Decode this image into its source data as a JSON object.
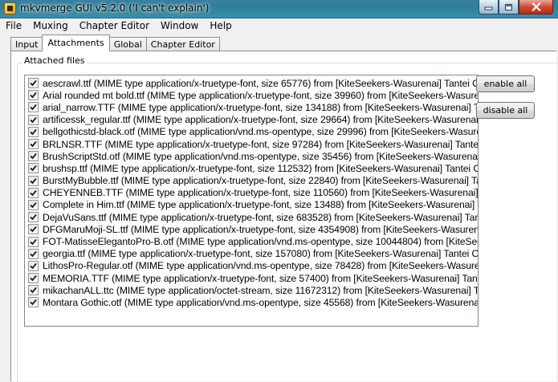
{
  "window": {
    "title": "mkvmerge GUI v5.2.0 ('I can't explain')",
    "controls": [
      "minimize",
      "maximize",
      "close"
    ]
  },
  "menu": [
    "File",
    "Muxing",
    "Chapter Editor",
    "Window",
    "Help"
  ],
  "tabs": [
    {
      "label": "Input",
      "active": false
    },
    {
      "label": "Attachments",
      "active": true
    },
    {
      "label": "Global",
      "active": false
    },
    {
      "label": "Chapter Editor",
      "active": false
    }
  ],
  "attached_files": {
    "label": "Attached files",
    "items": [
      {
        "checked": true,
        "text": "aescrawl.ttf (MIME type application/x-truetype-font, size 65776) from [KiteSeekers-Wasurenai] Tantei Opera"
      },
      {
        "checked": true,
        "text": "Arial rounded mt bold.ttf (MIME type application/x-truetype-font, size 39960) from [KiteSeekers-Wasurenai] T"
      },
      {
        "checked": true,
        "text": "arial_narrow.TTF (MIME type application/x-truetype-font, size 134188) from [KiteSeekers-Wasurenai] Tantei O"
      },
      {
        "checked": true,
        "text": "artificessk_regular.ttf (MIME type application/x-truetype-font, size 29664) from [KiteSeekers-Wasurenai] Tant"
      },
      {
        "checked": true,
        "text": "bellgothicstd-black.otf (MIME type application/vnd.ms-opentype, size 29996) from [KiteSeekers-Wasurenai] Ta"
      },
      {
        "checked": true,
        "text": "BRLNSR.TTF (MIME type application/x-truetype-font, size 97284) from [KiteSeekers-Wasurenai] Tantei Opera"
      },
      {
        "checked": true,
        "text": "BrushScriptStd.otf (MIME type application/vnd.ms-opentype, size 35456) from [KiteSeekers-Wasurenai] Tante"
      },
      {
        "checked": true,
        "text": "brushsp.ttf (MIME type application/x-truetype-font, size 112532) from [KiteSeekers-Wasurenai] Tantei Opera"
      },
      {
        "checked": true,
        "text": "BurstMyBubble.ttf (MIME type application/x-truetype-font, size 22840) from [KiteSeekers-Wasurenai] Tantei O"
      },
      {
        "checked": true,
        "text": "CHEYENNEB.TTF (MIME type application/x-truetype-font, size 110560) from [KiteSeekers-Wasurenai] Tantei O"
      },
      {
        "checked": true,
        "text": "Complete in Him.ttf (MIME type application/x-truetype-font, size 13488) from [KiteSeekers-Wasurenai] Tantei"
      },
      {
        "checked": true,
        "text": "DejaVuSans.ttf (MIME type application/x-truetype-font, size 683528) from [KiteSeekers-Wasurenai] Tantei Op"
      },
      {
        "checked": true,
        "text": "DFGMaruMoji-SL.ttf (MIME type application/x-truetype-font, size 4354908) from [KiteSeekers-Wasurenai] Tan"
      },
      {
        "checked": true,
        "text": "FOT-MatisseElegantoPro-B.otf (MIME type application/vnd.ms-opentype, size 10044804) from [KiteSeekers-W"
      },
      {
        "checked": true,
        "text": "georgia.ttf (MIME type application/x-truetype-font, size 157080) from [KiteSeekers-Wasurenai] Tantei Opera"
      },
      {
        "checked": true,
        "text": "LithosPro-Regular.otf (MIME type application/vnd.ms-opentype, size 78428) from [KiteSeekers-Wasurenai] Tan"
      },
      {
        "checked": true,
        "text": "MEMORIA.TTF (MIME type application/x-truetype-font, size 57400) from [KiteSeekers-Wasurenai] Tantei Oper"
      },
      {
        "checked": true,
        "text": "mikachanALL.ttc (MIME type application/octet-stream, size 11672312) from [KiteSeekers-Wasurenai] Tantei O"
      },
      {
        "checked": true,
        "text": "Montara Gothic.otf (MIME type application/vnd.ms-opentype, size 45568) from [KiteSeekers-Wasurenai] Tante"
      }
    ]
  },
  "buttons": {
    "enable_all": "enable all",
    "disable_all": "disable all"
  }
}
